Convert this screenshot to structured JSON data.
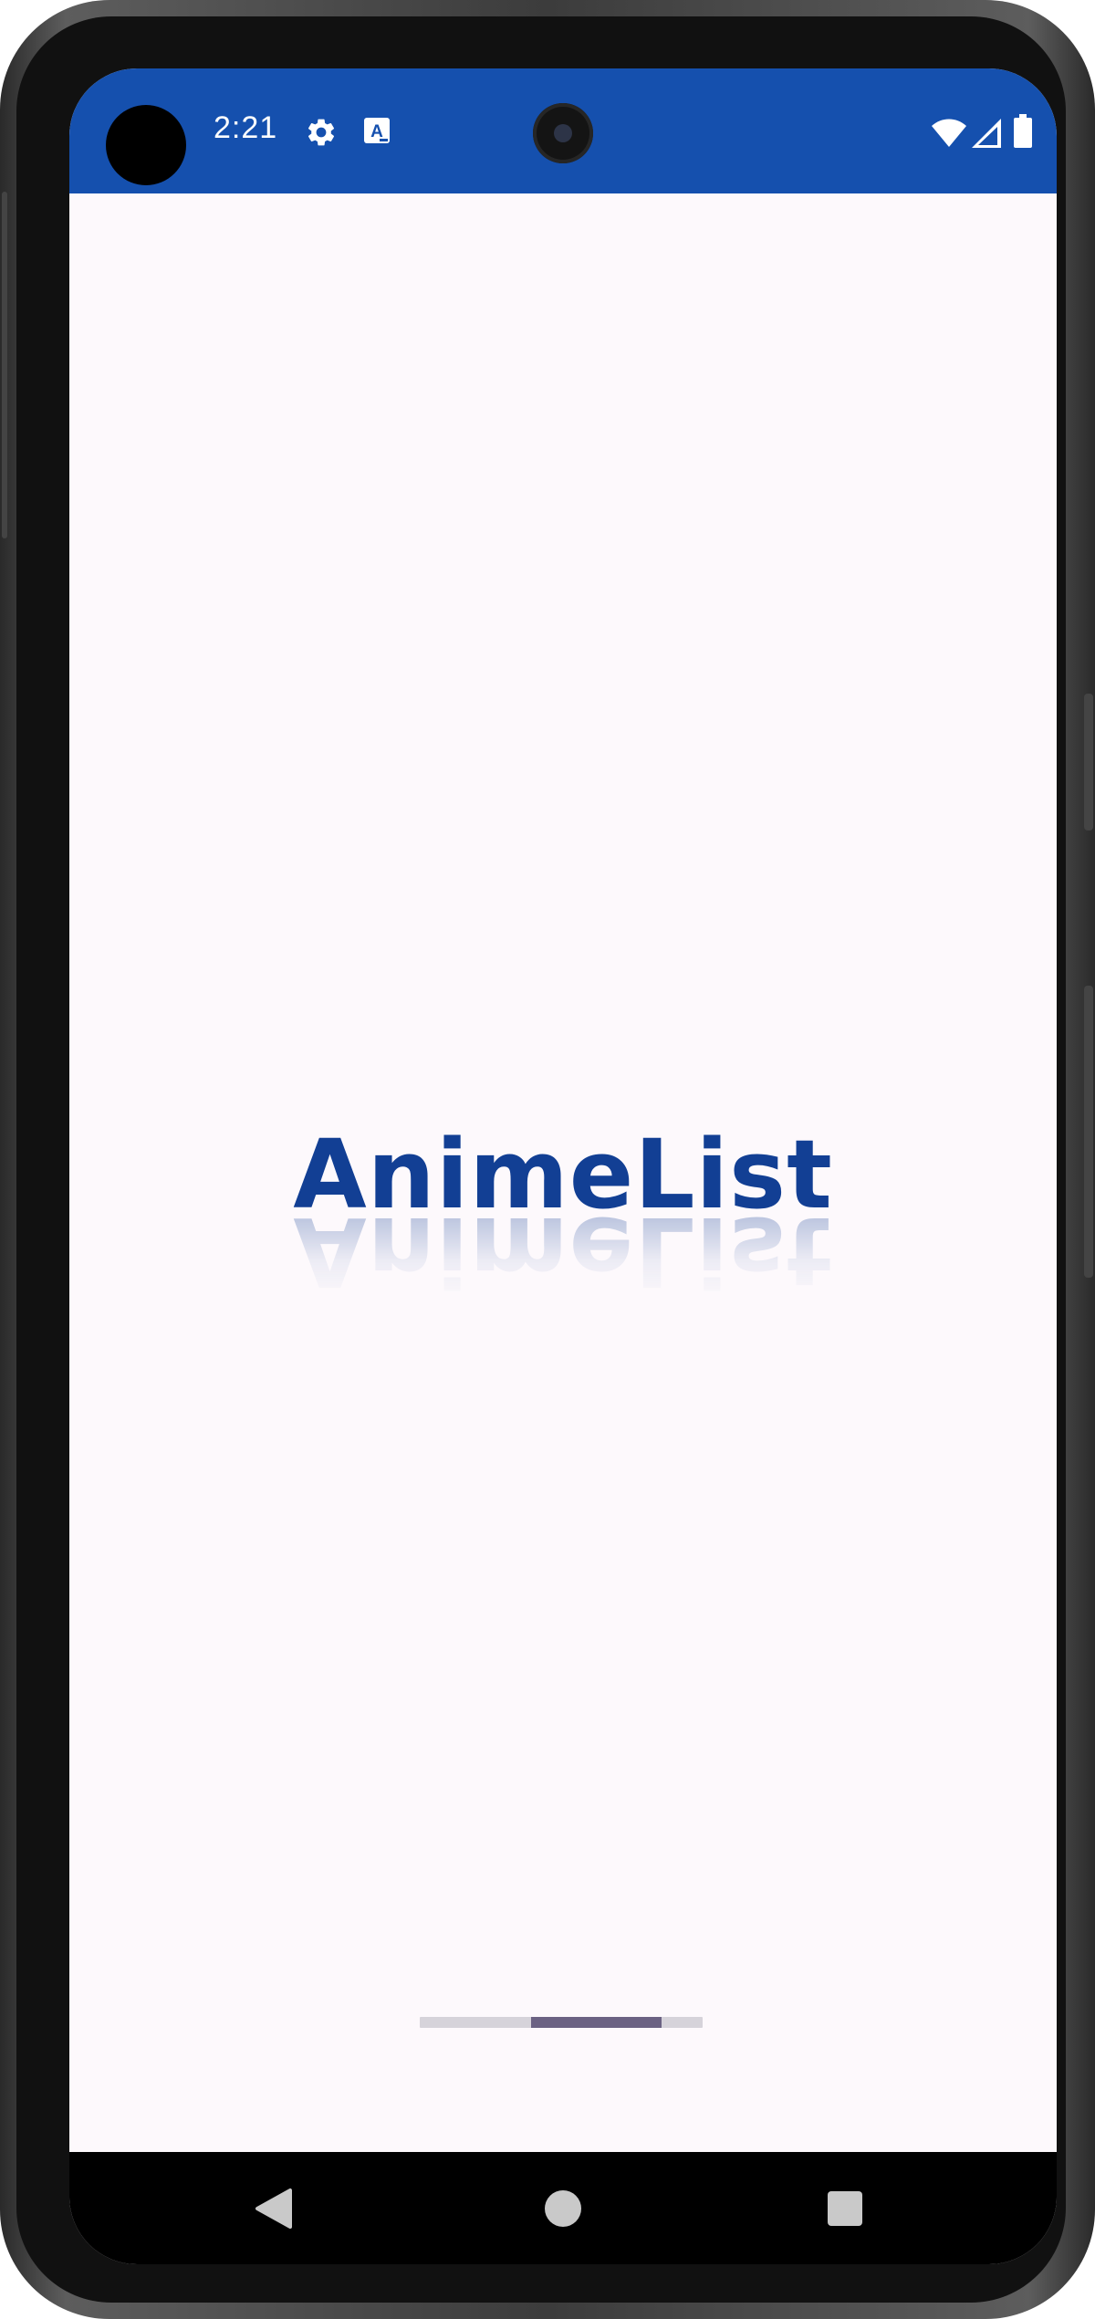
{
  "status_bar": {
    "time": "2:21",
    "background_color": "#1550ae",
    "left_icons": [
      "settings-gear-icon",
      "text-a-icon"
    ],
    "right_icons": [
      "wifi-icon",
      "cell-signal-icon",
      "battery-icon"
    ]
  },
  "app": {
    "logo_text": "AnimeList",
    "logo_color": "#123f94",
    "background_color": "#fdf9fc"
  },
  "loading": {
    "indicator_color": "#6b6283",
    "track_color": "#d6d3da"
  },
  "nav_bar": {
    "buttons": [
      "back-triangle-icon",
      "home-circle-icon",
      "recents-square-icon"
    ]
  }
}
